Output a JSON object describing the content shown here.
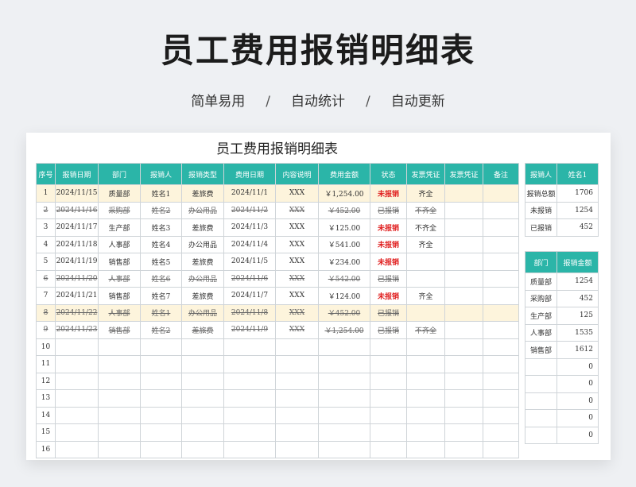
{
  "hero": {
    "title": "员工费用报销明细表",
    "tag1": "简单易用",
    "tag2": "自动统计",
    "tag3": "自动更新",
    "separator": "/"
  },
  "sheet": {
    "title": "员工费用报销明细表",
    "headers": [
      "序号",
      "报销日期",
      "部门",
      "报销人",
      "报销类型",
      "费用日期",
      "内容说明",
      "费用金额",
      "状态",
      "发票凭证",
      "发票凭证",
      "备注"
    ],
    "rows": [
      {
        "no": "1",
        "date": "2024/11/15",
        "dept": "质量部",
        "person": "姓名1",
        "type": "差旅费",
        "fdate": "2024/11/1",
        "desc": "XXX",
        "amount": "￥1,254.00",
        "status": "未报销",
        "invoice": "齐全",
        "invoice2": "",
        "note": ""
      },
      {
        "no": "2",
        "date": "2024/11/16",
        "dept": "采购部",
        "person": "姓名2",
        "type": "办公用品",
        "fdate": "2024/11/2",
        "desc": "XXX",
        "amount": "￥452.00",
        "status": "已报销",
        "invoice": "不齐全",
        "invoice2": "",
        "note": ""
      },
      {
        "no": "3",
        "date": "2024/11/17",
        "dept": "生产部",
        "person": "姓名3",
        "type": "差旅费",
        "fdate": "2024/11/3",
        "desc": "XXX",
        "amount": "￥125.00",
        "status": "未报销",
        "invoice": "不齐全",
        "invoice2": "",
        "note": ""
      },
      {
        "no": "4",
        "date": "2024/11/18",
        "dept": "人事部",
        "person": "姓名4",
        "type": "办公用品",
        "fdate": "2024/11/4",
        "desc": "XXX",
        "amount": "￥541.00",
        "status": "未报销",
        "invoice": "齐全",
        "invoice2": "",
        "note": ""
      },
      {
        "no": "5",
        "date": "2024/11/19",
        "dept": "销售部",
        "person": "姓名5",
        "type": "差旅费",
        "fdate": "2024/11/5",
        "desc": "XXX",
        "amount": "￥234.00",
        "status": "未报销",
        "invoice": "",
        "invoice2": "",
        "note": ""
      },
      {
        "no": "6",
        "date": "2024/11/20",
        "dept": "人事部",
        "person": "姓名6",
        "type": "办公用品",
        "fdate": "2024/11/6",
        "desc": "XXX",
        "amount": "￥542.00",
        "status": "已报销",
        "invoice": "",
        "invoice2": "",
        "note": ""
      },
      {
        "no": "7",
        "date": "2024/11/21",
        "dept": "销售部",
        "person": "姓名7",
        "type": "差旅费",
        "fdate": "2024/11/7",
        "desc": "XXX",
        "amount": "￥124.00",
        "status": "未报销",
        "invoice": "齐全",
        "invoice2": "",
        "note": ""
      },
      {
        "no": "8",
        "date": "2024/11/22",
        "dept": "人事部",
        "person": "姓名1",
        "type": "办公用品",
        "fdate": "2024/11/8",
        "desc": "XXX",
        "amount": "￥452.00",
        "status": "已报销",
        "invoice": "",
        "invoice2": "",
        "note": ""
      },
      {
        "no": "9",
        "date": "2024/11/23",
        "dept": "销售部",
        "person": "姓名2",
        "type": "差旅费",
        "fdate": "2024/11/9",
        "desc": "XXX",
        "amount": "￥1,254.00",
        "status": "已报销",
        "invoice": "不齐全",
        "invoice2": "",
        "note": ""
      },
      {
        "no": "10",
        "date": "",
        "dept": "",
        "person": "",
        "type": "",
        "fdate": "",
        "desc": "",
        "amount": "",
        "status": "",
        "invoice": "",
        "invoice2": "",
        "note": ""
      },
      {
        "no": "11",
        "date": "",
        "dept": "",
        "person": "",
        "type": "",
        "fdate": "",
        "desc": "",
        "amount": "",
        "status": "",
        "invoice": "",
        "invoice2": "",
        "note": ""
      },
      {
        "no": "12",
        "date": "",
        "dept": "",
        "person": "",
        "type": "",
        "fdate": "",
        "desc": "",
        "amount": "",
        "status": "",
        "invoice": "",
        "invoice2": "",
        "note": ""
      },
      {
        "no": "13",
        "date": "",
        "dept": "",
        "person": "",
        "type": "",
        "fdate": "",
        "desc": "",
        "amount": "",
        "status": "",
        "invoice": "",
        "invoice2": "",
        "note": ""
      },
      {
        "no": "14",
        "date": "",
        "dept": "",
        "person": "",
        "type": "",
        "fdate": "",
        "desc": "",
        "amount": "",
        "status": "",
        "invoice": "",
        "invoice2": "",
        "note": ""
      },
      {
        "no": "15",
        "date": "",
        "dept": "",
        "person": "",
        "type": "",
        "fdate": "",
        "desc": "",
        "amount": "",
        "status": "",
        "invoice": "",
        "invoice2": "",
        "note": ""
      },
      {
        "no": "16",
        "date": "",
        "dept": "",
        "person": "",
        "type": "",
        "fdate": "",
        "desc": "",
        "amount": "",
        "status": "",
        "invoice": "",
        "invoice2": "",
        "note": ""
      }
    ]
  },
  "summary1": {
    "headers": [
      "报销人",
      "姓名1"
    ],
    "rows": [
      {
        "label": "报销总额",
        "value": "1706"
      },
      {
        "label": "未报销",
        "value": "1254"
      },
      {
        "label": "已报销",
        "value": "452"
      }
    ]
  },
  "summary2": {
    "headers": [
      "部门",
      "报销金额"
    ],
    "rows": [
      {
        "label": "质量部",
        "value": "1254"
      },
      {
        "label": "采购部",
        "value": "452"
      },
      {
        "label": "生产部",
        "value": "125"
      },
      {
        "label": "人事部",
        "value": "1535"
      },
      {
        "label": "销售部",
        "value": "1612"
      },
      {
        "label": "",
        "value": "0"
      },
      {
        "label": "",
        "value": "0"
      },
      {
        "label": "",
        "value": "0"
      },
      {
        "label": "",
        "value": "0"
      },
      {
        "label": "",
        "value": "0"
      }
    ]
  },
  "colors": {
    "header_bg": "#2bb5a8",
    "highlight_row": "#fdf4dc",
    "unpaid_status": "#e02020"
  }
}
